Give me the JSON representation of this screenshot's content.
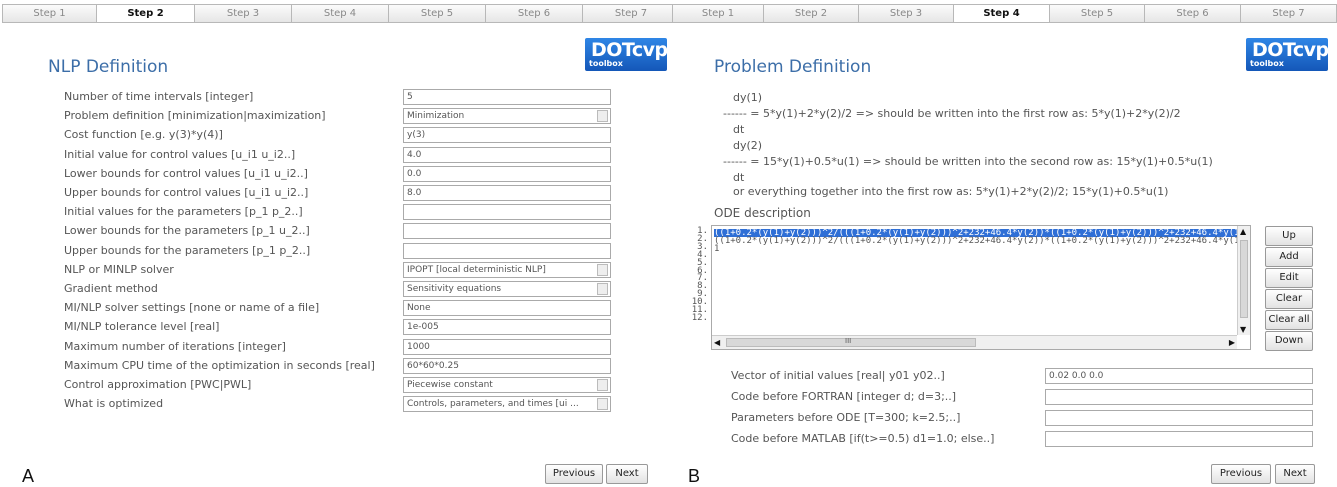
{
  "panelA": {
    "tabs": [
      "Step 1",
      "Step 2",
      "Step 3",
      "Step 4",
      "Step 5",
      "Step 6",
      "Step 7"
    ],
    "active_tab": "Step 2",
    "logo": {
      "main": "DOTcvp",
      "sub": "toolbox"
    },
    "title": "NLP Definition",
    "fields": [
      {
        "label": "Number of time intervals [integer]",
        "value": "5",
        "dropdown": false
      },
      {
        "label": "Problem definition [minimization|maximization]",
        "value": "Minimization",
        "dropdown": true
      },
      {
        "label": "Cost function [e.g. y(3)*y(4)]",
        "value": "y(3)",
        "dropdown": false
      },
      {
        "label": "Initial value for control values [u_i1 u_i2..]",
        "value": "4.0",
        "dropdown": false
      },
      {
        "label": "Lower bounds for control values [u_i1 u_i2..]",
        "value": "0.0",
        "dropdown": false
      },
      {
        "label": "Upper bounds for control values [u_i1 u_i2..]",
        "value": "8.0",
        "dropdown": false
      },
      {
        "label": "Initial values for the parameters [p_1 p_2..]",
        "value": "",
        "dropdown": false
      },
      {
        "label": "Lower bounds for the parameters [p_1 u_2..]",
        "value": "",
        "dropdown": false
      },
      {
        "label": "Upper bounds for the parameters [p_1 p_2..]",
        "value": "",
        "dropdown": false
      },
      {
        "label": "NLP or MINLP solver",
        "value": "IPOPT [local deterministic NLP]",
        "dropdown": true
      },
      {
        "label": "Gradient method",
        "value": "Sensitivity equations",
        "dropdown": true
      },
      {
        "label": "MI/NLP solver settings [none or name of a file]",
        "value": "None",
        "dropdown": false
      },
      {
        "label": "MI/NLP tolerance level [real]",
        "value": "1e-005",
        "dropdown": false
      },
      {
        "label": "Maximum number of iterations [integer]",
        "value": "1000",
        "dropdown": false
      },
      {
        "label": "Maximum CPU time of the optimization in seconds [real]",
        "value": "60*60*0.25",
        "dropdown": false
      },
      {
        "label": "Control approximation [PWC|PWL]",
        "value": "Piecewise constant",
        "dropdown": true
      },
      {
        "label": "What is optimized",
        "value": "Controls, parameters, and times [ui ...",
        "dropdown": true
      }
    ],
    "buttons": {
      "previous": "Previous",
      "next": "Next"
    },
    "figure_label": "A"
  },
  "panelB": {
    "tabs": [
      "Step 1",
      "Step 2",
      "Step 3",
      "Step 4",
      "Step 5",
      "Step 6",
      "Step 7"
    ],
    "active_tab": "Step 4",
    "logo": {
      "main": "DOTcvp",
      "sub": "toolbox"
    },
    "title": "Problem Definition",
    "example_lines": [
      "dy(1)",
      "------ = 5*y(1)+2*y(2)/2 => should be written into the first row as: 5*y(1)+2*y(2)/2",
      "dt",
      "dy(2)",
      "------ = 15*y(1)+0.5*u(1) => should be written into the second row as: 15*y(1)+0.5*u(1)",
      "dt",
      "or everything together into the first row as: 5*y(1)+2*y(2)/2; 15*y(1)+0.5*u(1)"
    ],
    "ode_label": "ODE description",
    "line_numbers": [
      "1.",
      "2.",
      "3.",
      "4.",
      "5.",
      "6.",
      "7.",
      "8.",
      "9.",
      "10.",
      "11.",
      "12."
    ],
    "ode_lines": [
      "((1+0.2*(y(1)+y(2)))^2/(((1+0.2*(y(1)+y(2)))^2+232+46.4*y(2))*((1+0.2*(y(1)+y(2)))^2+232+46.4*y(1)",
      "((1+0.2*(y(1)+y(2)))^2/(((1+0.2*(y(1)+y(2)))^2+232+46.4*y(2))*((1+0.2*(y(1)+y(2)))^2+232+46.4*y(1)",
      "1"
    ],
    "side_buttons": [
      "Up",
      "Add",
      "Edit",
      "Clear",
      "Clear all",
      "Down"
    ],
    "scroll_glyph": "III",
    "fields": [
      {
        "label": "Vector of initial values [real| y01 y02..]",
        "value": "0.02 0.0 0.0"
      },
      {
        "label": "Code before FORTRAN [integer d; d=3;..]",
        "value": ""
      },
      {
        "label": "Parameters before ODE [T=300; k=2.5;..]",
        "value": ""
      },
      {
        "label": "Code before MATLAB [if(t>=0.5) d1=1.0; else..]",
        "value": ""
      }
    ],
    "buttons": {
      "previous": "Previous",
      "next": "Next"
    },
    "figure_label": "B"
  },
  "colors": {
    "title": "#3c6ea8",
    "logo": "#1f6fd6",
    "selection": "#2f6fd6"
  }
}
